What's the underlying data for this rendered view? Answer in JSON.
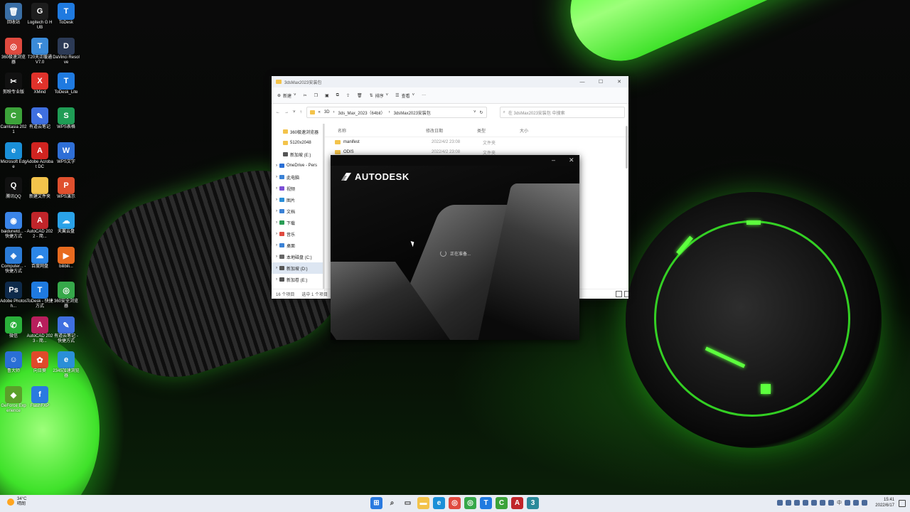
{
  "desktop_icons": [
    {
      "label": "回收站",
      "glyph": "🗑",
      "color": "#3a6ea5"
    },
    {
      "label": "Logitech G HUB",
      "glyph": "G",
      "color": "#1d1d1d"
    },
    {
      "label": "ToDesk",
      "glyph": "T",
      "color": "#1f7ae0"
    },
    {
      "label": "360极速浏览器",
      "glyph": "◎",
      "color": "#e04a3f"
    },
    {
      "label": "T20天正暖通V7.0",
      "glyph": "T",
      "color": "#3b8ad8"
    },
    {
      "label": "DaVinci Resolve",
      "glyph": "D",
      "color": "#2c3a55"
    },
    {
      "label": "剪映专业版",
      "glyph": "✂",
      "color": "#111111"
    },
    {
      "label": "XMind",
      "glyph": "X",
      "color": "#e0322b"
    },
    {
      "label": "ToDesk_Lite",
      "glyph": "T",
      "color": "#1f7ae0"
    },
    {
      "label": "Camtasia 2021",
      "glyph": "C",
      "color": "#3ca33a"
    },
    {
      "label": "有道云笔记",
      "glyph": "✎",
      "color": "#3f6fe0"
    },
    {
      "label": "WPS表格",
      "glyph": "S",
      "color": "#1f9d55"
    },
    {
      "label": "Microsoft Edge",
      "glyph": "e",
      "color": "#1a8fd8"
    },
    {
      "label": "Adobe Acrobat DC",
      "glyph": "A",
      "color": "#d02420"
    },
    {
      "label": "WPS文字",
      "glyph": "W",
      "color": "#2f6fd6"
    },
    {
      "label": "腾讯QQ",
      "glyph": "Q",
      "color": "#111111"
    },
    {
      "label": "新建文件夹",
      "glyph": "",
      "color": "#f3c34b"
    },
    {
      "label": "WPS演示",
      "glyph": "P",
      "color": "#e0502e"
    },
    {
      "label": "baidunetd... - 快捷方式",
      "glyph": "◉",
      "color": "#3a84e8"
    },
    {
      "label": "AutoCAD 2022 - 简...",
      "glyph": "A",
      "color": "#c0252a"
    },
    {
      "label": "天翼云盘",
      "glyph": "☁",
      "color": "#2aa2e8"
    },
    {
      "label": "Computer... - 快捷方式",
      "glyph": "◈",
      "color": "#2b7bd6"
    },
    {
      "label": "百度网盘",
      "glyph": "☁",
      "color": "#2c86e8"
    },
    {
      "label": "bilibili...",
      "glyph": "▶",
      "color": "#e86b1f"
    },
    {
      "label": "Adobe Photosh...",
      "glyph": "Ps",
      "color": "#0e2a4a"
    },
    {
      "label": "ToDesk - 快捷方式",
      "glyph": "T",
      "color": "#1f7ae0"
    },
    {
      "label": "360安全浏览器",
      "glyph": "◎",
      "color": "#36a84a"
    },
    {
      "label": "微信",
      "glyph": "✆",
      "color": "#2ab03a"
    },
    {
      "label": "AutoCAD 2023 - 简...",
      "glyph": "A",
      "color": "#b81f5c"
    },
    {
      "label": "有道云笔记 - 快捷方式",
      "glyph": "✎",
      "color": "#3f6fe0"
    },
    {
      "label": "鲁大师",
      "glyph": "☺",
      "color": "#2a6fd6"
    },
    {
      "label": "向日葵",
      "glyph": "✿",
      "color": "#e04a2a"
    },
    {
      "label": "2345加速浏览器",
      "glyph": "e",
      "color": "#2a8fd8"
    },
    {
      "label": "GeForce Experience",
      "glyph": "◆",
      "color": "#5aa02a"
    },
    {
      "label": "FlashFXP",
      "glyph": "f",
      "color": "#2a7ae0"
    }
  ],
  "explorer": {
    "title": "3dsMax2023安装包",
    "toolbar": {
      "new": "新建",
      "sort": "排序",
      "view": "查看",
      "more": "···"
    },
    "breadcrumb": [
      "3D",
      "3ds_Max_2023（64bit）",
      "3dsMax2023安装包"
    ],
    "search_placeholder": "在 3dsMax2023安装包 中搜索",
    "nav_items": [
      {
        "label": "360极速浏览器",
        "color": "#f3c34b"
      },
      {
        "label": "5120x2048",
        "color": "#f3c34b"
      },
      {
        "label": "新加坡 (E:)",
        "color": "#555555"
      },
      {
        "label": "OneDrive - Pers",
        "color": "#2a6fd6"
      },
      {
        "label": "此电脑",
        "color": "#3b82d6"
      },
      {
        "label": "视频",
        "color": "#7b4fd6"
      },
      {
        "label": "图片",
        "color": "#2a8fd8"
      },
      {
        "label": "文档",
        "color": "#3b82d6"
      },
      {
        "label": "下载",
        "color": "#2a9d55"
      },
      {
        "label": "音乐",
        "color": "#e04a3f"
      },
      {
        "label": "桌面",
        "color": "#3b82d6"
      },
      {
        "label": "本地磁盘 (C:)",
        "color": "#666666"
      },
      {
        "label": "新加坡 (D:)",
        "color": "#555555"
      },
      {
        "label": "新加卷 (E:)",
        "color": "#555555"
      }
    ],
    "columns": {
      "name": "名称",
      "date": "修改日期",
      "type": "类型",
      "size": "大小"
    },
    "rows": [
      {
        "name": "manifest",
        "date": "2022/4/2 23:08",
        "type": "文件夹"
      },
      {
        "name": "ODIS",
        "date": "2022/4/2 23:08",
        "type": "文件夹"
      }
    ],
    "status_count": "16 个项目",
    "status_selected": "选中 1 个项目"
  },
  "splash": {
    "brand": "AUTODESK",
    "loading": "正在准备..."
  },
  "taskbar": {
    "weather_temp": "34°C",
    "weather_desc": "晴朗",
    "apps": [
      {
        "name": "start",
        "glyph": "⊞",
        "color": "#2a7ae0"
      },
      {
        "name": "search",
        "glyph": "⌕",
        "color": "#333333"
      },
      {
        "name": "task-view",
        "glyph": "▭",
        "color": "#333333"
      },
      {
        "name": "file-explorer",
        "glyph": "▬",
        "color": "#f3c34b"
      },
      {
        "name": "edge",
        "glyph": "e",
        "color": "#1a8fd8"
      },
      {
        "name": "360-browser",
        "glyph": "◎",
        "color": "#e04a3f"
      },
      {
        "name": "360-safe-browser",
        "glyph": "◎",
        "color": "#36a84a"
      },
      {
        "name": "todesk",
        "glyph": "T",
        "color": "#1f7ae0"
      },
      {
        "name": "camtasia",
        "glyph": "C",
        "color": "#3ca33a"
      },
      {
        "name": "autocad",
        "glyph": "A",
        "color": "#c0252a"
      },
      {
        "name": "3dsmax",
        "glyph": "3",
        "color": "#2a8a9a"
      }
    ],
    "ime": "中",
    "time": "15:41",
    "date": "2022/6/17"
  }
}
